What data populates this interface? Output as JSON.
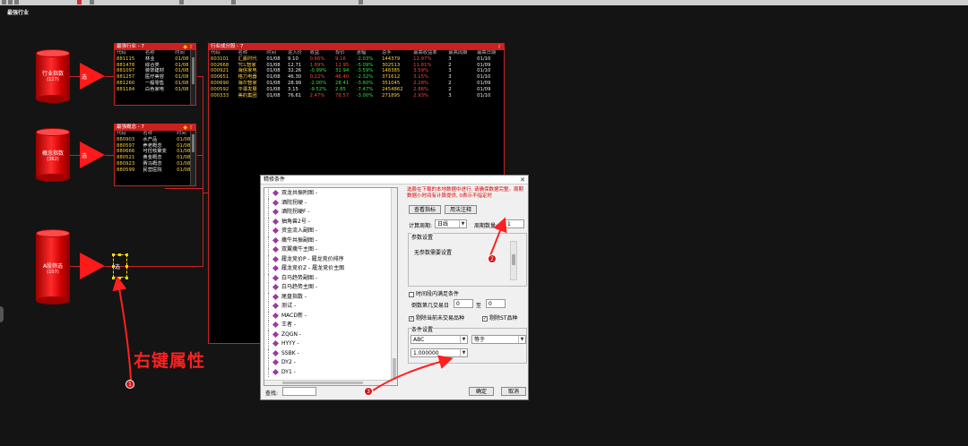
{
  "page_title": "最强行业",
  "cylinders": [
    {
      "label": "行业指数",
      "sub": "(127)"
    },
    {
      "label": "概念指数",
      "sub": "(362)"
    },
    {
      "label": "A股筛选",
      "sub": "(107)"
    }
  ],
  "triangles": [
    "选",
    "选",
    "选"
  ],
  "panel_industry": {
    "title": "最强行业 - 7",
    "headers": [
      "代码",
      "名称",
      "时间"
    ],
    "rows": [
      [
        "881115",
        "林业",
        "01/08"
      ],
      [
        "881478",
        "综合类",
        "01/08"
      ],
      [
        "881097",
        "装饰建材",
        "01/08"
      ],
      [
        "881257",
        "医疗美容",
        "01/08"
      ],
      [
        "881260",
        "一般零售",
        "01/08"
      ],
      [
        "881184",
        "白色家电",
        "01/08"
      ]
    ]
  },
  "panel_concept": {
    "title": "最强概念 - 7",
    "headers": [
      "代码",
      "名称",
      "时间"
    ],
    "rows": [
      [
        "880903",
        "水产品",
        "01/08"
      ],
      [
        "880597",
        "养老概念",
        "01/08"
      ],
      [
        "880666",
        "可控核聚变",
        "01/08"
      ],
      [
        "880521",
        "黄金概念",
        "01/08"
      ],
      [
        "880923",
        "赛马概念",
        "01/08"
      ],
      [
        "880599",
        "民营医院",
        "01/08"
      ]
    ]
  },
  "panel_stocks": {
    "title": "行业成分股 - 7",
    "headers": [
      "代码",
      "名称",
      "时间",
      "进入价",
      "收益",
      "现价",
      "涨幅",
      "总手",
      "最高收益率",
      "最高周期",
      "最高日期"
    ],
    "rows": [
      {
        "cells": [
          "603101",
          "汇嘉时代",
          "01/08",
          "9.10",
          "0.66%",
          "9.16",
          "-2.03%",
          "144379",
          "12.97%",
          "3",
          "01/10"
        ],
        "c": [
          "",
          "",
          "",
          "",
          "up",
          "up",
          "dn",
          "y",
          "up",
          "",
          ""
        ]
      },
      {
        "cells": [
          "002668",
          "TCL智家",
          "01/08",
          "12.71",
          "1.89%",
          "12.95",
          "-5.09%",
          "302513",
          "11.81%",
          "2",
          "01/09"
        ],
        "c": [
          "",
          "",
          "",
          "",
          "up",
          "up",
          "dn",
          "y",
          "up",
          "",
          ""
        ]
      },
      {
        "cells": [
          "000921",
          "海信家电",
          "01/08",
          "32.26",
          "-0.99%",
          "31.94",
          "-3.59%",
          "148385",
          "3.59%",
          "3",
          "01/10"
        ],
        "c": [
          "",
          "",
          "",
          "",
          "dn",
          "dn",
          "dn",
          "y",
          "up",
          "",
          ""
        ]
      },
      {
        "cells": [
          "000651",
          "格力电器",
          "01/08",
          "46.30",
          "0.22%",
          "46.40",
          "-2.32%",
          "371612",
          "3.15%",
          "3",
          "01/10"
        ],
        "c": [
          "",
          "",
          "",
          "",
          "up",
          "up",
          "dn",
          "y",
          "up",
          "",
          ""
        ]
      },
      {
        "cells": [
          "600690",
          "海尔智家",
          "01/08",
          "28.99",
          "-2.00%",
          "28.41",
          "-3.60%",
          "351045",
          "2.28%",
          "2",
          "01/09"
        ],
        "c": [
          "",
          "",
          "",
          "",
          "dn",
          "dn",
          "dn",
          "y",
          "up",
          "",
          ""
        ]
      },
      {
        "cells": [
          "000592",
          "平潭发展",
          "01/08",
          "3.15",
          "-9.52%",
          "2.85",
          "-7.47%",
          "2454862",
          "2.86%",
          "2",
          "01/09"
        ],
        "c": [
          "",
          "",
          "",
          "",
          "dn",
          "dn",
          "dn",
          "y",
          "up",
          "",
          ""
        ]
      },
      {
        "cells": [
          "000333",
          "美的集团",
          "01/08",
          "76.61",
          "2.47%",
          "78.57",
          "-3.00%",
          "271895",
          "2.93%",
          "3",
          "01/10"
        ],
        "c": [
          "",
          "",
          "",
          "",
          "up",
          "up",
          "dn",
          "y",
          "up",
          "",
          ""
        ]
      }
    ]
  },
  "dialog": {
    "title": "精修条件",
    "tree_items": [
      "双龙共振附图 -",
      "酒院拐硬 -",
      "酒院拐硬F -",
      "抽角兽2号 -",
      "资金流入副图 -",
      "擒牛共振副图 -",
      "双翼擒牛主图 -",
      "履龙竞价P - 履龙竞价排序",
      "履龙竞价Z - 履龙竞价主图",
      "白马趋势副图 -",
      "白马趋势主图 -",
      "尾盘指数 -",
      "测试 -",
      "MACD新 -",
      "王者 -",
      "ZQGN -",
      "HYYY -",
      "SSBK -",
      "DY2 -",
      "DY1 -"
    ],
    "find_label": "查找:",
    "note": "选股在下载的本地数据中进行, 请确保数据完整。周期数据小时间有计算提供, 0表示不指定时",
    "btn_view_formula": "查看指标",
    "btn_usage": "用法注释",
    "period_label": "计算周期:",
    "period_value": "日线",
    "cycle_label": "周期数量:",
    "cycle_value": "1",
    "params_title": "参数设置",
    "params_empty": "无参数需要设置",
    "time_range_label": "时间段内满足条件",
    "range_label": "倒数第几交易日",
    "range_from": "0",
    "range_to_label": "至",
    "range_to": "0",
    "exclude_suspended": "剔除当前未交易品种",
    "exclude_st": "剔除ST品种",
    "cond_title": "条件设置",
    "cond_line": "ABC",
    "cond_op": "等于",
    "cond_value": "1.000000",
    "ok_label": "确定",
    "cancel_label": "取消"
  },
  "annotations": {
    "text": "右键属性",
    "badges": [
      "1",
      "2",
      "3"
    ]
  }
}
